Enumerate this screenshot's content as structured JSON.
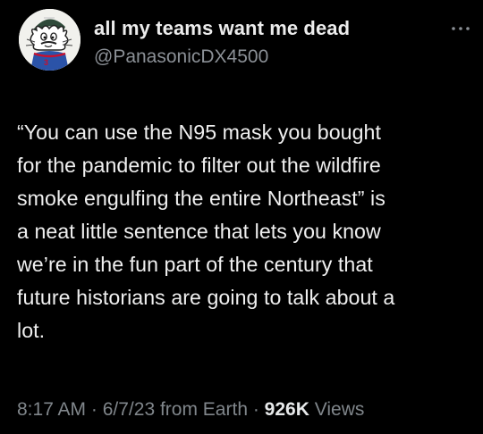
{
  "author": {
    "display_name": "all my teams want me dead",
    "handle": "@PanasonicDX4500",
    "avatar": "cartoon-cat-avatar"
  },
  "icons": {
    "more": "more-horizontal-icon"
  },
  "tweet": {
    "text": "“You can use the N95 mask you bought\nfor the pandemic to filter out the wildfire\nsmoke engulfing the entire Northeast” is\na neat little sentence that lets you know\nwe’re in the fun part of the century that\nfuture historians are going to talk about a\nlot."
  },
  "meta": {
    "time": "8:17 AM",
    "separator": " · ",
    "date": "6/7/23",
    "source": "from Earth",
    "views_count": "926K",
    "views_label": "Views"
  },
  "colors": {
    "background": "#000000",
    "text": "#e7e9ea",
    "secondary_text": "#80868b",
    "jersey_blue": "#2b53a8",
    "jersey_red": "#c8102e"
  }
}
